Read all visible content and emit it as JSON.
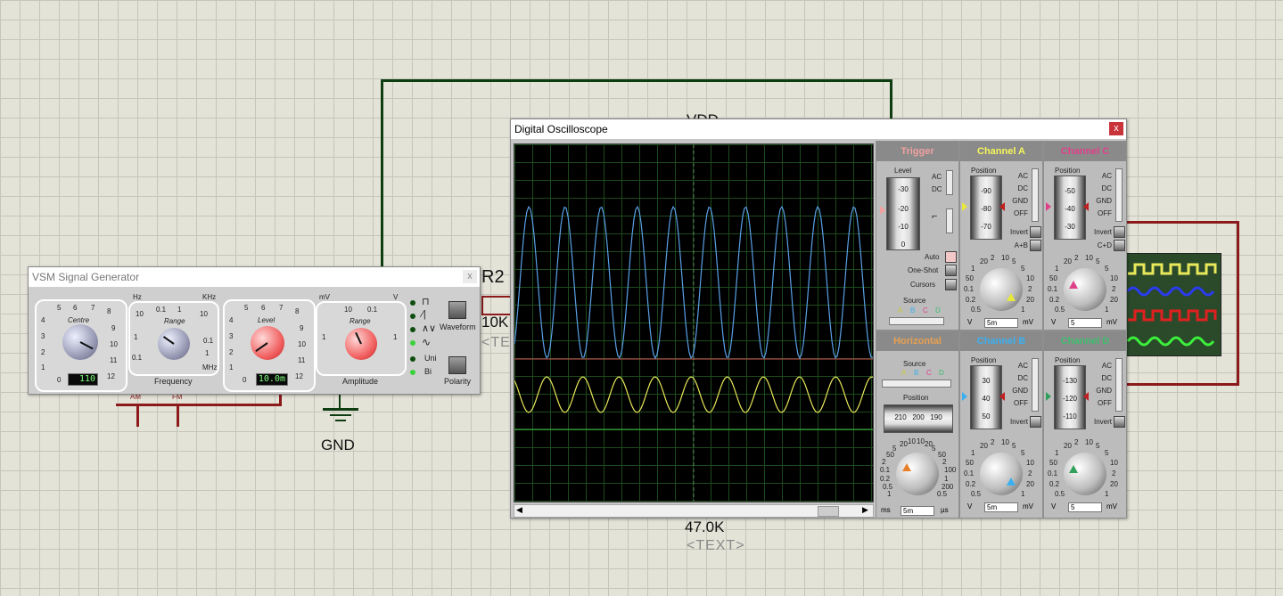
{
  "schematic": {
    "vdd_label": "VDD",
    "gnd_label": "GND",
    "r2_label": "R2",
    "r2_value": "10K",
    "r2_text": "<TEXT>",
    "r_bottom_value": "47.0K",
    "r_bottom_text": "<TEXT>",
    "am_label": "AM",
    "fm_label": "FM",
    "plus_label": "+"
  },
  "signal_generator": {
    "title": "VSM Signal Generator",
    "close_label": "x",
    "centre": {
      "label": "Centre",
      "scale": [
        "5",
        "6",
        "7",
        "8",
        "4",
        "9",
        "3",
        "10",
        "2",
        "11",
        "1",
        "12",
        "0"
      ],
      "display": "110"
    },
    "frequency_range": {
      "label": "Range",
      "caption": "Frequency",
      "unit_left": "Hz",
      "unit_right": "KHz",
      "unit_bottom": "MHz",
      "scale": [
        "10",
        "0.1",
        "1",
        "10",
        "1",
        "0.1",
        "0.1",
        "1"
      ]
    },
    "level": {
      "label": "Level",
      "scale": [
        "5",
        "6",
        "7",
        "8",
        "4",
        "9",
        "3",
        "10",
        "2",
        "11",
        "1",
        "12",
        "0"
      ],
      "display": "10.0m"
    },
    "amplitude_range": {
      "label": "Range",
      "caption": "Amplitude",
      "unit_left": "mV",
      "unit_right": "V",
      "scale": [
        "10",
        "0.1",
        "1",
        "1"
      ]
    },
    "waveform_label": "Waveform",
    "uni_label": "Uni",
    "bi_label": "Bi",
    "polarity_label": "Polarity",
    "led_on_color": "#3ad23a",
    "led_off_color": "#0d4d0d"
  },
  "oscilloscope": {
    "title": "Digital Oscilloscope",
    "close_label": "x",
    "trace_colors": {
      "blue": "#5aa0e6",
      "yellow": "#e8e85a",
      "red": "#c85050",
      "green": "#3fbf3f"
    },
    "trigger": {
      "title": "Trigger",
      "title_color": "#f0a0a0",
      "level_label": "Level",
      "level_scale": [
        "-30",
        "-20",
        "-10",
        "0"
      ],
      "ac": "AC",
      "dc": "DC",
      "auto_label": "Auto",
      "oneshot_label": "One-Shot",
      "cursors_label": "Cursors",
      "source_label": "Source",
      "source_options": [
        "A",
        "B",
        "C",
        "D"
      ]
    },
    "channel_a": {
      "title": "Channel A",
      "title_color": "#f5f55a",
      "position_label": "Position",
      "position_scale": [
        "-90",
        "-80",
        "-70"
      ],
      "coupling": [
        "AC",
        "DC",
        "GND",
        "OFF"
      ],
      "invert_label": "Invert",
      "extra_label": "A+B",
      "dial_scale": [
        "0.5",
        "0.2",
        "0.1",
        "50",
        "1",
        "20",
        "2",
        "10",
        "5",
        "5",
        "10",
        "2",
        "20",
        "1"
      ],
      "unit_left": "V",
      "unit_right": "mV",
      "input_value": "5m"
    },
    "channel_c": {
      "title": "Channel C",
      "title_color": "#e0408a",
      "position_label": "Position",
      "position_scale": [
        "-50",
        "-40",
        "-30"
      ],
      "coupling": [
        "AC",
        "DC",
        "GND",
        "OFF"
      ],
      "invert_label": "Invert",
      "extra_label": "C+D",
      "dial_scale": [
        "0.5",
        "0.2",
        "0.1",
        "50",
        "1",
        "20",
        "2",
        "10",
        "5",
        "5",
        "10",
        "2",
        "20",
        "1"
      ],
      "unit_left": "V",
      "unit_right": "mV",
      "input_value": "5"
    },
    "horizontal": {
      "title": "Horizontal",
      "title_color": "#e8a050",
      "source_label": "Source",
      "source_options": [
        "A",
        "B",
        "C",
        "D"
      ],
      "position_label": "Position",
      "position_scale": [
        "210",
        "200",
        "190"
      ],
      "dial_scale": [
        "1",
        "0.5",
        "0.2",
        "0.1",
        "2",
        "50",
        "5",
        "20",
        "10",
        "10",
        "20",
        "5",
        "50",
        "2",
        "100",
        "1",
        "200",
        "0.5"
      ],
      "unit_left": "ms",
      "unit_right": "µs",
      "input_value": "5m"
    },
    "channel_b": {
      "title": "Channel B",
      "title_color": "#3ab0f0",
      "position_label": "Position",
      "position_scale": [
        "30",
        "40",
        "50"
      ],
      "coupling": [
        "AC",
        "DC",
        "GND",
        "OFF"
      ],
      "invert_label": "Invert",
      "dial_scale": [
        "0.5",
        "0.2",
        "0.1",
        "50",
        "1",
        "20",
        "2",
        "10",
        "5",
        "5",
        "10",
        "2",
        "20",
        "1"
      ],
      "unit_left": "V",
      "unit_right": "mV",
      "input_value": "5m"
    },
    "channel_d": {
      "title": "Channel D",
      "title_color": "#3fbf6f",
      "position_label": "Position",
      "position_scale": [
        "-130",
        "-120",
        "-110"
      ],
      "coupling": [
        "AC",
        "DC",
        "GND",
        "OFF"
      ],
      "invert_label": "Invert",
      "dial_scale": [
        "0.5",
        "0.2",
        "0.1",
        "50",
        "1",
        "20",
        "2",
        "10",
        "5",
        "5",
        "10",
        "2",
        "20",
        "1"
      ],
      "unit_left": "V",
      "unit_right": "mV",
      "input_value": "5"
    }
  }
}
